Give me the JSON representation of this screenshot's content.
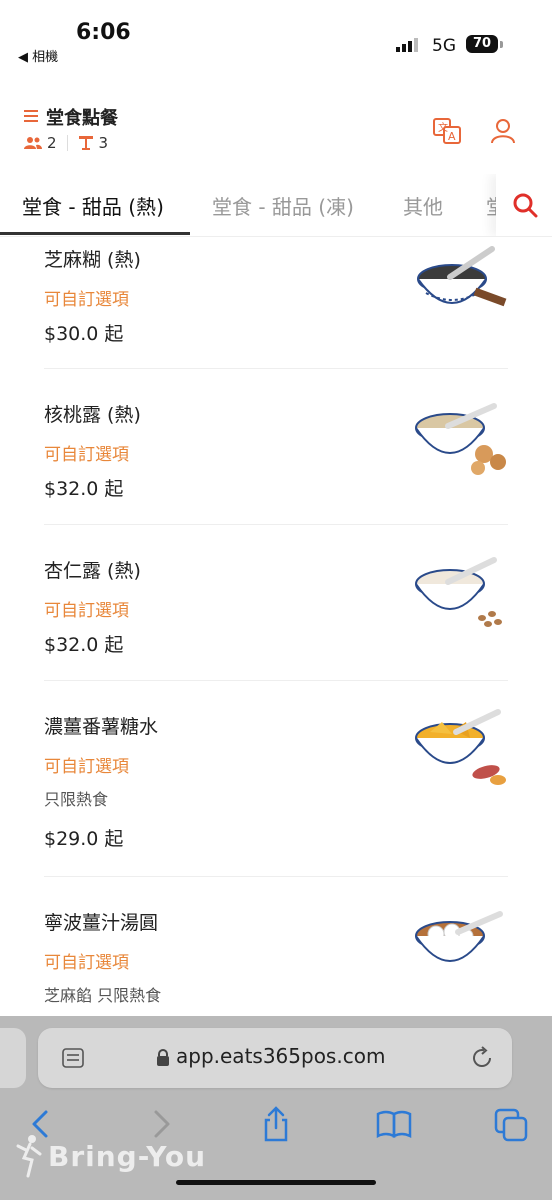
{
  "status_bar": {
    "time": "6:06",
    "back_label": "◀ 相機",
    "network": "5G",
    "battery": "70"
  },
  "header": {
    "title": "堂食點餐",
    "guests": "2",
    "table": "3"
  },
  "tabs": [
    {
      "label": "堂食 - 甜品 (熱)",
      "active": true
    },
    {
      "label": "堂食 - 甜品 (凍)",
      "active": false
    },
    {
      "label": "其他",
      "active": false
    },
    {
      "label": "堂",
      "active": false
    }
  ],
  "items": [
    {
      "name": "芝麻糊 (熱)",
      "option": "可自訂選項",
      "note": "",
      "price": "$30.0 起",
      "image": "black-sesame-soup"
    },
    {
      "name": "核桃露 (熱)",
      "option": "可自訂選項",
      "note": "",
      "price": "$32.0 起",
      "image": "walnut-soup"
    },
    {
      "name": "杏仁露 (熱)",
      "option": "可自訂選項",
      "note": "",
      "price": "$32.0 起",
      "image": "almond-soup"
    },
    {
      "name": "濃薑番薯糖水",
      "option": "可自訂選項",
      "note": "只限熱食",
      "price": "$29.0 起",
      "image": "ginger-sweet-potato-soup"
    },
    {
      "name": "寧波薑汁湯圓",
      "option": "可自訂選項",
      "note": "芝麻餡  只限熱食",
      "price": "",
      "image": "ginger-glutinous-rice-balls"
    }
  ],
  "browser": {
    "url": "app.eats365pos.com"
  },
  "watermark": "Bring-You",
  "colors": {
    "accent": "#e8673a",
    "option": "#e8873a",
    "search": "#e0302a"
  }
}
